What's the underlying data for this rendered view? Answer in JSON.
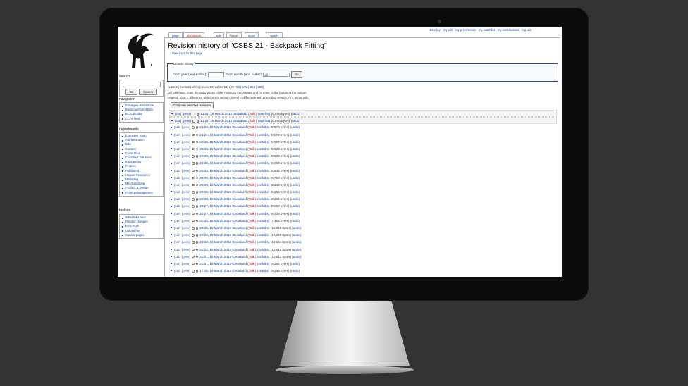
{
  "page": {
    "title": "Revision history of \"CSBS 21 - Backpack Fitting\"",
    "subtitle": "View logs for this page"
  },
  "personal": [
    "Econley",
    "my talk",
    "my preferences",
    "my watchlist",
    "my contributions",
    "log out"
  ],
  "tabs": [
    {
      "label": "page",
      "state": "normal"
    },
    {
      "label": "discussion",
      "state": "red"
    },
    {
      "label": "edit",
      "state": "normal"
    },
    {
      "label": "history",
      "state": "selected"
    },
    {
      "label": "move",
      "state": "normal"
    },
    {
      "label": "watch",
      "state": "normal"
    }
  ],
  "search": {
    "title": "search",
    "go": "Go",
    "search": "Search"
  },
  "navigation": {
    "title": "navigation",
    "items": [
      "Employee Resources",
      "Backcountry Exhibits",
      "BC Calendar",
      "CCAT Help"
    ]
  },
  "departments": {
    "title": "departments",
    "items": [
      "Executive Team",
      "Administration",
      "Bike",
      "Content",
      "Costa Rica",
      "Customer Solutions",
      "Engineering",
      "Finance",
      "Fulfillment",
      "Human Resources",
      "Marketing",
      "Merchandising",
      "Product & Design",
      "Project Management"
    ]
  },
  "toolbox": {
    "title": "toolbox",
    "items": [
      "What links here",
      "Related changes",
      "RSS Atom",
      "Upload file",
      "Special pages"
    ]
  },
  "browse": {
    "legend": "Browse history",
    "year_label": "From year (and earlier):",
    "month_label": "From month (and earlier):",
    "month_value": "all",
    "go": "Go"
  },
  "nav": {
    "prefix": "(Latest | Earliest) View (newer 50) (older 50) (",
    "links": [
      "20",
      "50",
      "100",
      "250",
      "500"
    ],
    "suffix": ")"
  },
  "help": {
    "line1": "Diff selection: mark the radio boxes of the revisions to compare and hit enter or the button at the bottom.",
    "line2": "Legend: (cur) = difference with current version, (prev) = difference with preceding version, m = minor edit."
  },
  "compare_button": "Compare selected revisions",
  "labels": {
    "cur": "cur",
    "prev": "prev",
    "talk": "Talk",
    "contribs": "contribs",
    "undo": "undo"
  },
  "revisions": [
    {
      "time": "21:27, 19 March 2013",
      "user": "Gnowland",
      "bytes": "(9,076 bytes)",
      "hl": true
    },
    {
      "time": "21:27, 19 March 2013",
      "user": "Gnowland",
      "bytes": "(9,076 bytes)",
      "hl": true
    },
    {
      "time": "21:22, 19 March 2013",
      "user": "Gnowland",
      "bytes": "(9,076 bytes)"
    },
    {
      "time": "21:21, 19 March 2013",
      "user": "Gnowland",
      "bytes": "(9,078 bytes)"
    },
    {
      "time": "20:45, 19 March 2013",
      "user": "Gnowland",
      "bytes": "(8,907 bytes)"
    },
    {
      "time": "20:43, 19 March 2013",
      "user": "Gnowland",
      "bytes": "(8,923 bytes)"
    },
    {
      "time": "20:40, 19 March 2013",
      "user": "Gnowland",
      "bytes": "(8,863 bytes)"
    },
    {
      "time": "20:35, 19 March 2013",
      "user": "Gnowland",
      "bytes": "(8,863 bytes)"
    },
    {
      "time": "20:33, 19 March 2013",
      "user": "Gnowland",
      "bytes": "(8,843 bytes)"
    },
    {
      "time": "20:30, 19 March 2013",
      "user": "Gnowland",
      "bytes": "(8,798 bytes)"
    },
    {
      "time": "20:29, 19 March 2013",
      "user": "Gnowland",
      "bytes": "(8,243 bytes)"
    },
    {
      "time": "20:28, 19 March 2013",
      "user": "Gnowland",
      "bytes": "(8,259 bytes)"
    },
    {
      "time": "20:28, 19 March 2013",
      "user": "Gnowland",
      "bytes": "(8,236 bytes)"
    },
    {
      "time": "20:27, 19 March 2013",
      "user": "Gnowland",
      "bytes": "(8,068 bytes)"
    },
    {
      "time": "20:27, 19 March 2013",
      "user": "Gnowland",
      "bytes": "(8,108 bytes)"
    },
    {
      "time": "20:26, 19 March 2013",
      "user": "Gnowland",
      "bytes": "(7,456 bytes)"
    },
    {
      "time": "20:25, 19 March 2013",
      "user": "Gnowland",
      "bytes": "(10,646 bytes)"
    },
    {
      "time": "20:24, 19 March 2013",
      "user": "Gnowland",
      "bytes": "(10,646 bytes)"
    },
    {
      "time": "20:22, 19 March 2013",
      "user": "Gnowland",
      "bytes": "(10,644 bytes)"
    },
    {
      "time": "20:22, 19 March 2013",
      "user": "Gnowland",
      "bytes": "(10,612 bytes)"
    },
    {
      "time": "20:21, 19 March 2013",
      "user": "Gnowland",
      "bytes": "(10,613 bytes)"
    },
    {
      "time": "20:21, 19 March 2013",
      "user": "Gnowland",
      "bytes": "(9,266 bytes)"
    },
    {
      "time": "17:45, 19 March 2013",
      "user": "Gnowland",
      "bytes": "(9,269 bytes)"
    }
  ]
}
